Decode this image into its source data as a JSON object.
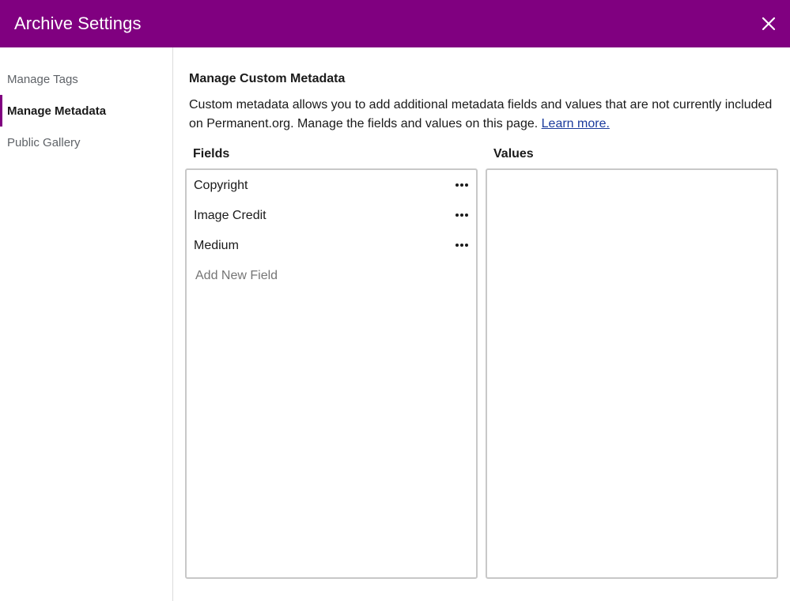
{
  "header": {
    "title": "Archive Settings",
    "close_icon": "close-icon",
    "background": "#800080"
  },
  "sidebar": {
    "items": [
      {
        "label": "Manage Tags",
        "active": false
      },
      {
        "label": "Manage Metadata",
        "active": true
      },
      {
        "label": "Public Gallery",
        "active": false
      }
    ]
  },
  "main": {
    "title": "Manage Custom Metadata",
    "description": "Custom metadata allows you to add additional metadata fields and values that are not currently included on Permanent.org. Manage the fields and values on this page.",
    "learn_more": "Learn more.",
    "fields_label": "Fields",
    "values_label": "Values",
    "fields": [
      {
        "label": "Copyright",
        "menu_icon": "more-horizontal-icon"
      },
      {
        "label": "Image Credit",
        "menu_icon": "more-horizontal-icon"
      },
      {
        "label": "Medium",
        "menu_icon": "more-horizontal-icon"
      }
    ],
    "add_field_placeholder": "Add New Field",
    "add_field_value": ""
  }
}
